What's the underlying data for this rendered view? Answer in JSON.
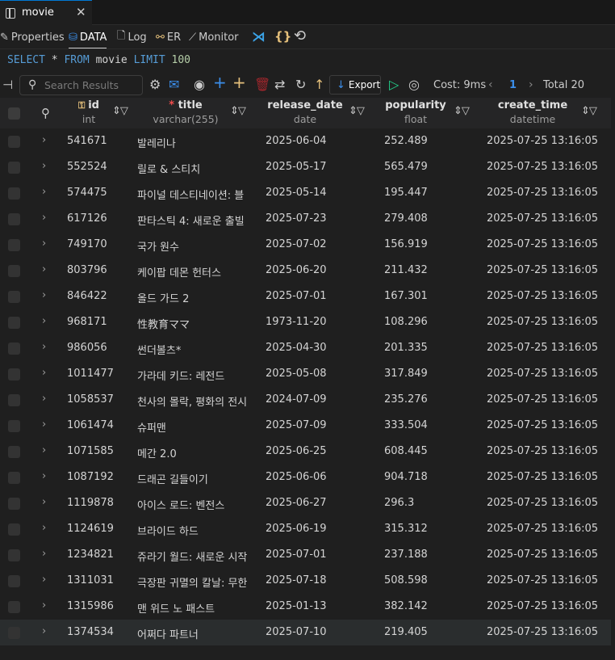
{
  "tab": {
    "label": "movie",
    "close": "✕"
  },
  "toolbar1": {
    "properties": "Properties",
    "data": "DATA",
    "log": "Log",
    "er": "ER",
    "monitor": "Monitor"
  },
  "sql": {
    "select": "SELECT",
    "star": "*",
    "from": "FROM",
    "table": "movie",
    "limit": "LIMIT",
    "limit_value": "100"
  },
  "toolbar2": {
    "search_placeholder": "Search Results",
    "export": "Export",
    "cost": "Cost: 9ms",
    "page": "1",
    "total": "Total 20"
  },
  "columns": [
    {
      "name": "id",
      "type": "int",
      "primary_key": true
    },
    {
      "name": "title",
      "type": "varchar(255)",
      "required": true
    },
    {
      "name": "release_date",
      "type": "date"
    },
    {
      "name": "popularity",
      "type": "float"
    },
    {
      "name": "create_time",
      "type": "datetime"
    }
  ],
  "rows": [
    [
      "541671",
      "발레리나",
      "2025-06-04",
      "252.489",
      "2025-07-25 13:16:05"
    ],
    [
      "552524",
      "릴로 & 스티치",
      "2025-05-17",
      "565.479",
      "2025-07-25 13:16:05"
    ],
    [
      "574475",
      "파이널 데스티네이션: 블",
      "2025-05-14",
      "195.447",
      "2025-07-25 13:16:05"
    ],
    [
      "617126",
      "판타스틱 4: 새로운 출빌",
      "2025-07-23",
      "279.408",
      "2025-07-25 13:16:05"
    ],
    [
      "749170",
      "국가 원수",
      "2025-07-02",
      "156.919",
      "2025-07-25 13:16:05"
    ],
    [
      "803796",
      "케이팝 데몬 헌터스",
      "2025-06-20",
      "211.432",
      "2025-07-25 13:16:05"
    ],
    [
      "846422",
      "올드 가드 2",
      "2025-07-01",
      "167.301",
      "2025-07-25 13:16:05"
    ],
    [
      "968171",
      "性教育ママ",
      "1973-11-20",
      "108.296",
      "2025-07-25 13:16:05"
    ],
    [
      "986056",
      "썬더볼츠*",
      "2025-04-30",
      "201.335",
      "2025-07-25 13:16:05"
    ],
    [
      "1011477",
      "가라데 키드: 레전드",
      "2025-05-08",
      "317.849",
      "2025-07-25 13:16:05"
    ],
    [
      "1058537",
      "천사의 몰락, 평화의 전시",
      "2024-07-09",
      "235.276",
      "2025-07-25 13:16:05"
    ],
    [
      "1061474",
      "슈퍼맨",
      "2025-07-09",
      "333.504",
      "2025-07-25 13:16:05"
    ],
    [
      "1071585",
      "메간 2.0",
      "2025-06-25",
      "608.445",
      "2025-07-25 13:16:05"
    ],
    [
      "1087192",
      "드래곤 길들이기",
      "2025-06-06",
      "904.718",
      "2025-07-25 13:16:05"
    ],
    [
      "1119878",
      "아이스 로드: 벤전스",
      "2025-06-27",
      "296.3",
      "2025-07-25 13:16:05"
    ],
    [
      "1124619",
      "브라이드 하드",
      "2025-06-19",
      "315.312",
      "2025-07-25 13:16:05"
    ],
    [
      "1234821",
      "쥬라기 월드: 새로운 시작",
      "2025-07-01",
      "237.188",
      "2025-07-25 13:16:05"
    ],
    [
      "1311031",
      "극장판 귀멸의 칼날: 무한",
      "2025-07-18",
      "508.598",
      "2025-07-25 13:16:05"
    ],
    [
      "1315986",
      "맨 위드 노 패스트",
      "2025-01-13",
      "382.142",
      "2025-07-25 13:16:05"
    ],
    [
      "1374534",
      "어쩌다 파트너",
      "2025-07-10",
      "219.405",
      "2025-07-25 13:16:05"
    ]
  ],
  "colors": {
    "accent": "#0078d4",
    "keyword": "#569cd6",
    "number": "#b5cea8",
    "link": "#3b8eea",
    "required": "#f14c4c"
  }
}
